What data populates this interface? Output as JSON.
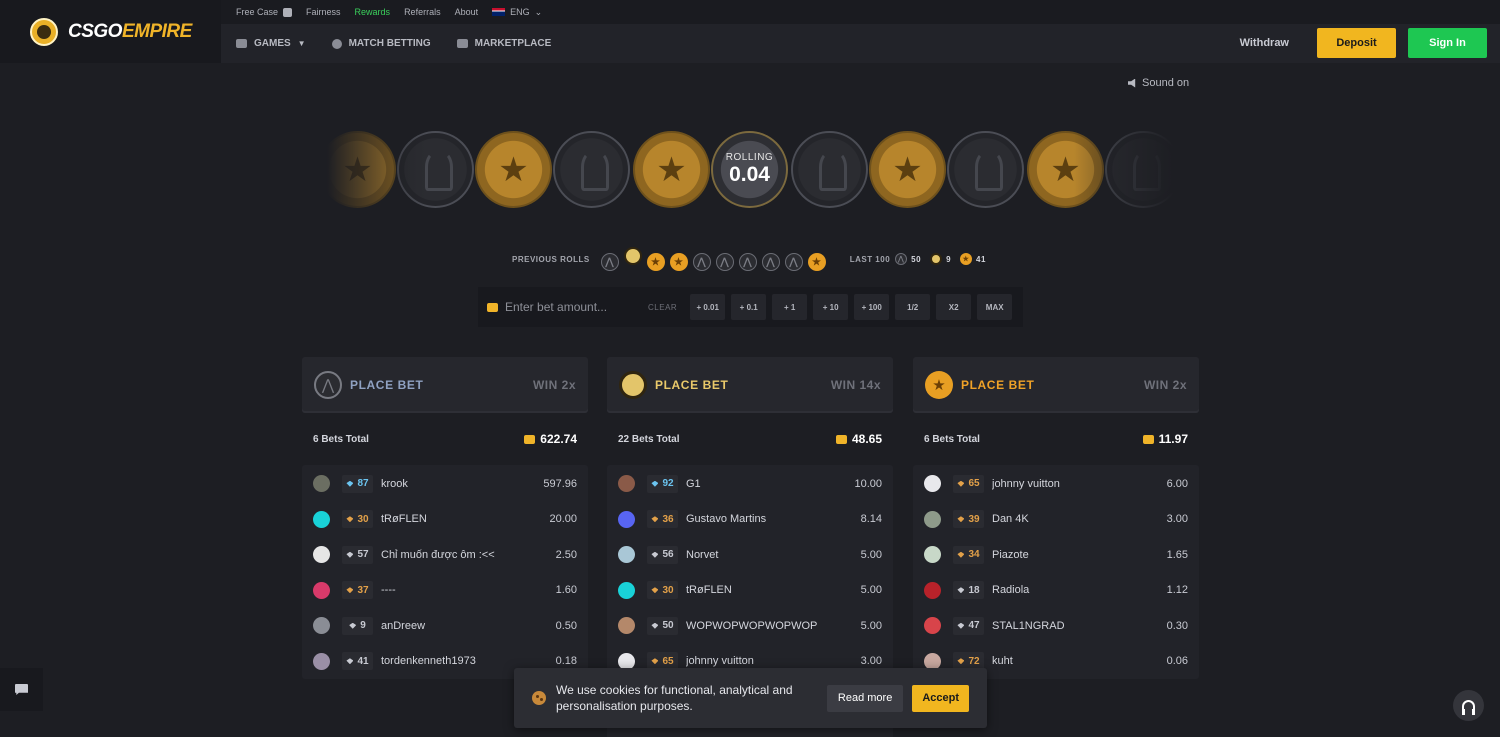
{
  "logo": {
    "part1": "CSGO",
    "part2": "EMPIRE"
  },
  "topbar": {
    "items": [
      "Free Case",
      "Fairness",
      "Rewards",
      "Referrals",
      "About"
    ],
    "lang": "ENG"
  },
  "nav": {
    "games": "GAMES",
    "match_betting": "MATCH BETTING",
    "marketplace": "MARKETPLACE",
    "withdraw": "Withdraw",
    "deposit": "Deposit",
    "signin": "Sign In"
  },
  "sound_label": "Sound on",
  "roller": {
    "label": "ROLLING",
    "value": "0.04"
  },
  "previous": {
    "label": "PREVIOUS ROLLS",
    "rolls": [
      "ct",
      "bonus",
      "t",
      "t",
      "ct",
      "ct",
      "ct",
      "ct",
      "ct",
      "t"
    ],
    "last100_label": "LAST 100",
    "ct_count": "50",
    "bonus_count": "9",
    "t_count": "41"
  },
  "bet": {
    "placeholder": "Enter bet amount...",
    "clear": "CLEAR",
    "quick": [
      "+ 0.01",
      "+ 0.1",
      "+ 1",
      "+ 10",
      "+ 100",
      "1/2",
      "X2",
      "MAX"
    ]
  },
  "columns": [
    {
      "place": "PLACE BET",
      "win": "WIN 2x",
      "bets_total": "6 Bets Total",
      "total": "622.74",
      "rows": [
        {
          "lvl": "87",
          "lvl_color": "blue",
          "name": "krook",
          "amount": "597.96",
          "avatar": "#6b6e62"
        },
        {
          "lvl": "30",
          "lvl_color": "orange",
          "name": "tRøFLEN",
          "amount": "20.00",
          "avatar": "#19d2d8"
        },
        {
          "lvl": "57",
          "lvl_color": "grey",
          "name": "Chỉ muốn được ôm :<<",
          "amount": "2.50",
          "avatar": "#e6e6e6"
        },
        {
          "lvl": "37",
          "lvl_color": "orange",
          "name": "----",
          "amount": "1.60",
          "avatar": "#d83a6a"
        },
        {
          "lvl": "9",
          "lvl_color": "grey",
          "name": "anDreew",
          "amount": "0.50",
          "avatar": "#8a8d95"
        },
        {
          "lvl": "41",
          "lvl_color": "grey",
          "name": "tordenkenneth1973",
          "amount": "0.18",
          "avatar": "#9a8fa6"
        }
      ]
    },
    {
      "place": "PLACE BET",
      "win": "WIN 14x",
      "bets_total": "22 Bets Total",
      "total": "48.65",
      "rows": [
        {
          "lvl": "92",
          "lvl_color": "blue",
          "name": "G1",
          "amount": "10.00",
          "avatar": "#8a5a48"
        },
        {
          "lvl": "36",
          "lvl_color": "orange",
          "name": "Gustavo Martins",
          "amount": "8.14",
          "avatar": "#5865f2"
        },
        {
          "lvl": "56",
          "lvl_color": "grey",
          "name": "Norvet",
          "amount": "5.00",
          "avatar": "#a9c7d6"
        },
        {
          "lvl": "30",
          "lvl_color": "orange",
          "name": "tRøFLEN",
          "amount": "5.00",
          "avatar": "#19d2d8"
        },
        {
          "lvl": "50",
          "lvl_color": "grey",
          "name": "WOPWOPWOPWOPWOP",
          "amount": "5.00",
          "avatar": "#b4886a"
        },
        {
          "lvl": "65",
          "lvl_color": "orange",
          "name": "johnny vuitton",
          "amount": "3.00",
          "avatar": "#e8e8ec"
        }
      ]
    },
    {
      "place": "PLACE BET",
      "win": "WIN 2x",
      "bets_total": "6 Bets Total",
      "total": "11.97",
      "rows": [
        {
          "lvl": "65",
          "lvl_color": "orange",
          "name": "johnny vuitton",
          "amount": "6.00",
          "avatar": "#e8e8ec"
        },
        {
          "lvl": "39",
          "lvl_color": "orange",
          "name": "Dan 4K",
          "amount": "3.00",
          "avatar": "#8e9a8a"
        },
        {
          "lvl": "34",
          "lvl_color": "orange",
          "name": "Piazote",
          "amount": "1.65",
          "avatar": "#c8d8c8"
        },
        {
          "lvl": "18",
          "lvl_color": "grey",
          "name": "Radiola",
          "amount": "1.12",
          "avatar": "#b8222a"
        },
        {
          "lvl": "47",
          "lvl_color": "grey",
          "name": "STAL1NGRAD",
          "amount": "0.30",
          "avatar": "#d8444a"
        },
        {
          "lvl": "72",
          "lvl_color": "orange",
          "name": "kuht",
          "amount": "0.06",
          "avatar": "#c8a8a0"
        }
      ]
    }
  ],
  "cookie": {
    "text": "We use cookies for functional, analytical and personalisation purposes.",
    "read_more": "Read more",
    "accept": "Accept"
  },
  "colors": {
    "accent_yellow": "#f1b61f",
    "accent_green": "#1ec752",
    "bg": "#1d1e23"
  }
}
